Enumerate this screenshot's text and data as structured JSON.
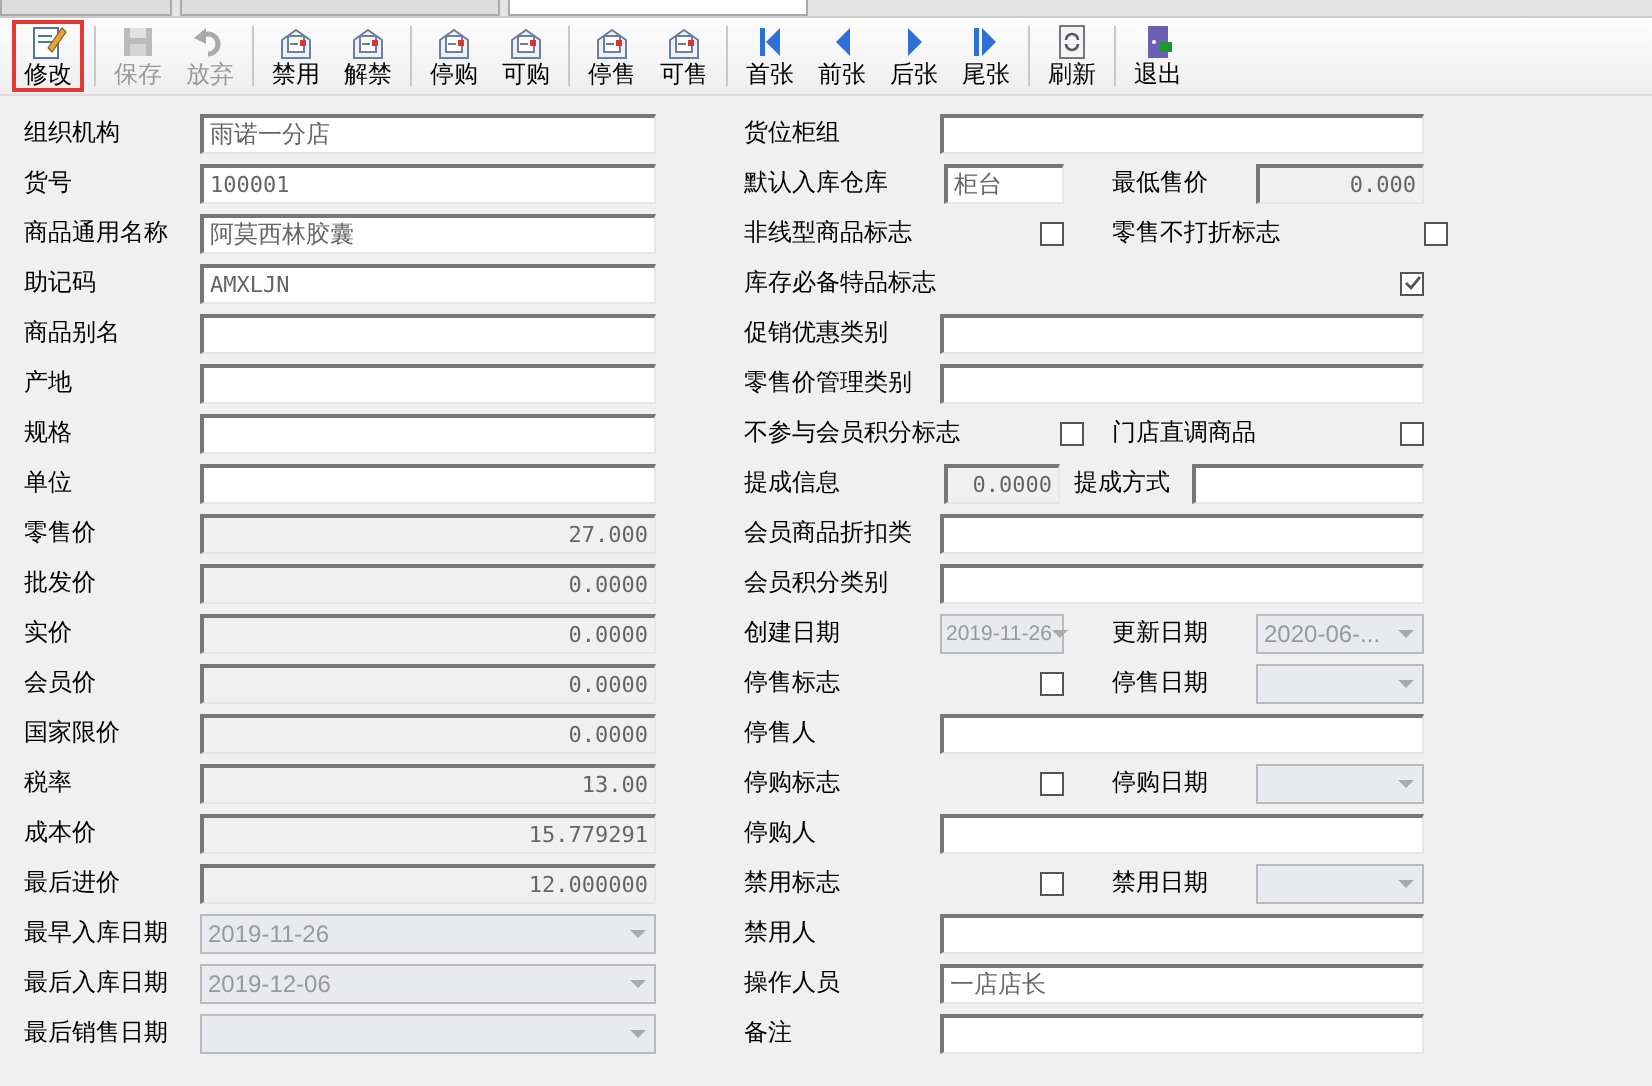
{
  "tabs": [
    {
      "selected": false
    },
    {
      "selected": false
    },
    {
      "selected": true
    }
  ],
  "toolbar": [
    [
      {
        "label": "修改",
        "kind": "edit",
        "disabled": false,
        "selected": true
      }
    ],
    [
      {
        "label": "保存",
        "kind": "save",
        "disabled": true,
        "selected": false
      },
      {
        "label": "放弃",
        "kind": "undo",
        "disabled": true,
        "selected": false
      }
    ],
    [
      {
        "label": "禁用",
        "kind": "doc",
        "disabled": false,
        "selected": false
      },
      {
        "label": "解禁",
        "kind": "doc",
        "disabled": false,
        "selected": false
      }
    ],
    [
      {
        "label": "停购",
        "kind": "doc",
        "disabled": false,
        "selected": false
      },
      {
        "label": "可购",
        "kind": "doc",
        "disabled": false,
        "selected": false
      }
    ],
    [
      {
        "label": "停售",
        "kind": "doc",
        "disabled": false,
        "selected": false
      },
      {
        "label": "可售",
        "kind": "doc",
        "disabled": false,
        "selected": false
      }
    ],
    [
      {
        "label": "首张",
        "kind": "first",
        "disabled": false,
        "selected": false
      },
      {
        "label": "前张",
        "kind": "prev",
        "disabled": false,
        "selected": false
      },
      {
        "label": "后张",
        "kind": "next",
        "disabled": false,
        "selected": false
      },
      {
        "label": "尾张",
        "kind": "last",
        "disabled": false,
        "selected": false
      }
    ],
    [
      {
        "label": "刷新",
        "kind": "refresh",
        "disabled": false,
        "selected": false
      }
    ],
    [
      {
        "label": "退出",
        "kind": "exit",
        "disabled": false,
        "selected": false
      }
    ]
  ],
  "left_fields": [
    {
      "label": "组织机构",
      "kind": "text",
      "value": "雨诺一分店"
    },
    {
      "label": "货号",
      "kind": "code",
      "value": "100001"
    },
    {
      "label": "商品通用名称",
      "kind": "text",
      "value": "阿莫西林胶囊"
    },
    {
      "label": "助记码",
      "kind": "code",
      "value": "AMXLJN"
    },
    {
      "label": "商品别名",
      "kind": "text"
    },
    {
      "label": "产地",
      "kind": "text"
    },
    {
      "label": "规格",
      "kind": "text"
    },
    {
      "label": "单位",
      "kind": "text"
    },
    {
      "label": "零售价",
      "kind": "number",
      "value": "27.000"
    },
    {
      "label": "批发价",
      "kind": "number",
      "value": "0.0000"
    },
    {
      "label": "实价",
      "kind": "number",
      "value": "0.0000"
    },
    {
      "label": "会员价",
      "kind": "number",
      "value": "0.0000"
    },
    {
      "label": "国家限价",
      "kind": "number",
      "value": "0.0000"
    },
    {
      "label": "税率",
      "kind": "number",
      "value": "13.00"
    },
    {
      "label": "成本价",
      "kind": "number",
      "value": "15.779291"
    },
    {
      "label": "最后进价",
      "kind": "number",
      "value": "12.000000"
    },
    {
      "label": "最早入库日期",
      "kind": "date",
      "value": "2019-11-26"
    },
    {
      "label": "最后入库日期",
      "kind": "date",
      "value": "2019-12-06"
    },
    {
      "label": "最后销售日期",
      "kind": "date"
    }
  ],
  "right_rows": [
    {
      "kind": "wide",
      "items": [
        {
          "label": "货位柜组",
          "kind": "text"
        }
      ]
    },
    {
      "kind": "pair",
      "items": [
        {
          "label": "默认入库仓库",
          "kind": "text",
          "value": "柜台"
        },
        {
          "label": "最低售价",
          "kind": "number",
          "value": "0.000"
        }
      ]
    },
    {
      "kind": "pair",
      "items": [
        {
          "label": "非线型商品标志",
          "kind": "checkbox",
          "checked": false
        },
        {
          "label": "零售不打折标志",
          "kind": "checkbox",
          "checked": false
        }
      ]
    },
    {
      "kind": "wide",
      "items": [
        {
          "label": "库存必备特品标志",
          "kind": "checkbox",
          "checked": true
        }
      ]
    },
    {
      "kind": "wide",
      "items": [
        {
          "label": "促销优惠类别",
          "kind": "text"
        }
      ]
    },
    {
      "kind": "wide",
      "items": [
        {
          "label": "零售价管理类别",
          "kind": "text"
        }
      ]
    },
    {
      "kind": "pair",
      "items": [
        {
          "label": "不参与会员积分标志",
          "kind": "checkbox",
          "checked": false
        },
        {
          "label": "门店直调商品",
          "kind": "checkbox",
          "checked": false
        }
      ]
    },
    {
      "kind": "split",
      "items": [
        {
          "label": "提成信息",
          "kind": "number",
          "value": "0.0000"
        },
        {
          "label": "提成方式",
          "kind": "text"
        }
      ]
    },
    {
      "kind": "wide",
      "items": [
        {
          "label": "会员商品折扣类",
          "kind": "text"
        }
      ]
    },
    {
      "kind": "wide",
      "items": [
        {
          "label": "会员积分类别",
          "kind": "text"
        }
      ]
    },
    {
      "kind": "pair",
      "items": [
        {
          "label": "创建日期",
          "kind": "date",
          "value": "2019-11-26"
        },
        {
          "label": "更新日期",
          "kind": "date",
          "value": "2020-06-..."
        }
      ]
    },
    {
      "kind": "pair",
      "items": [
        {
          "label": "停售标志",
          "kind": "checkbox",
          "checked": false
        },
        {
          "label": "停售日期",
          "kind": "date"
        }
      ]
    },
    {
      "kind": "wide",
      "items": [
        {
          "label": "停售人",
          "kind": "text"
        }
      ]
    },
    {
      "kind": "pair",
      "items": [
        {
          "label": "停购标志",
          "kind": "checkbox",
          "checked": false
        },
        {
          "label": "停购日期",
          "kind": "date"
        }
      ]
    },
    {
      "kind": "wide",
      "items": [
        {
          "label": "停购人",
          "kind": "text"
        }
      ]
    },
    {
      "kind": "pair",
      "items": [
        {
          "label": "禁用标志",
          "kind": "checkbox",
          "checked": false
        },
        {
          "label": "禁用日期",
          "kind": "date"
        }
      ]
    },
    {
      "kind": "wide",
      "items": [
        {
          "label": "禁用人",
          "kind": "text"
        }
      ]
    },
    {
      "kind": "wide",
      "items": [
        {
          "label": "操作人员",
          "kind": "text",
          "value": "一店店长"
        }
      ]
    },
    {
      "kind": "wide",
      "items": [
        {
          "label": "备注",
          "kind": "text"
        }
      ]
    }
  ]
}
